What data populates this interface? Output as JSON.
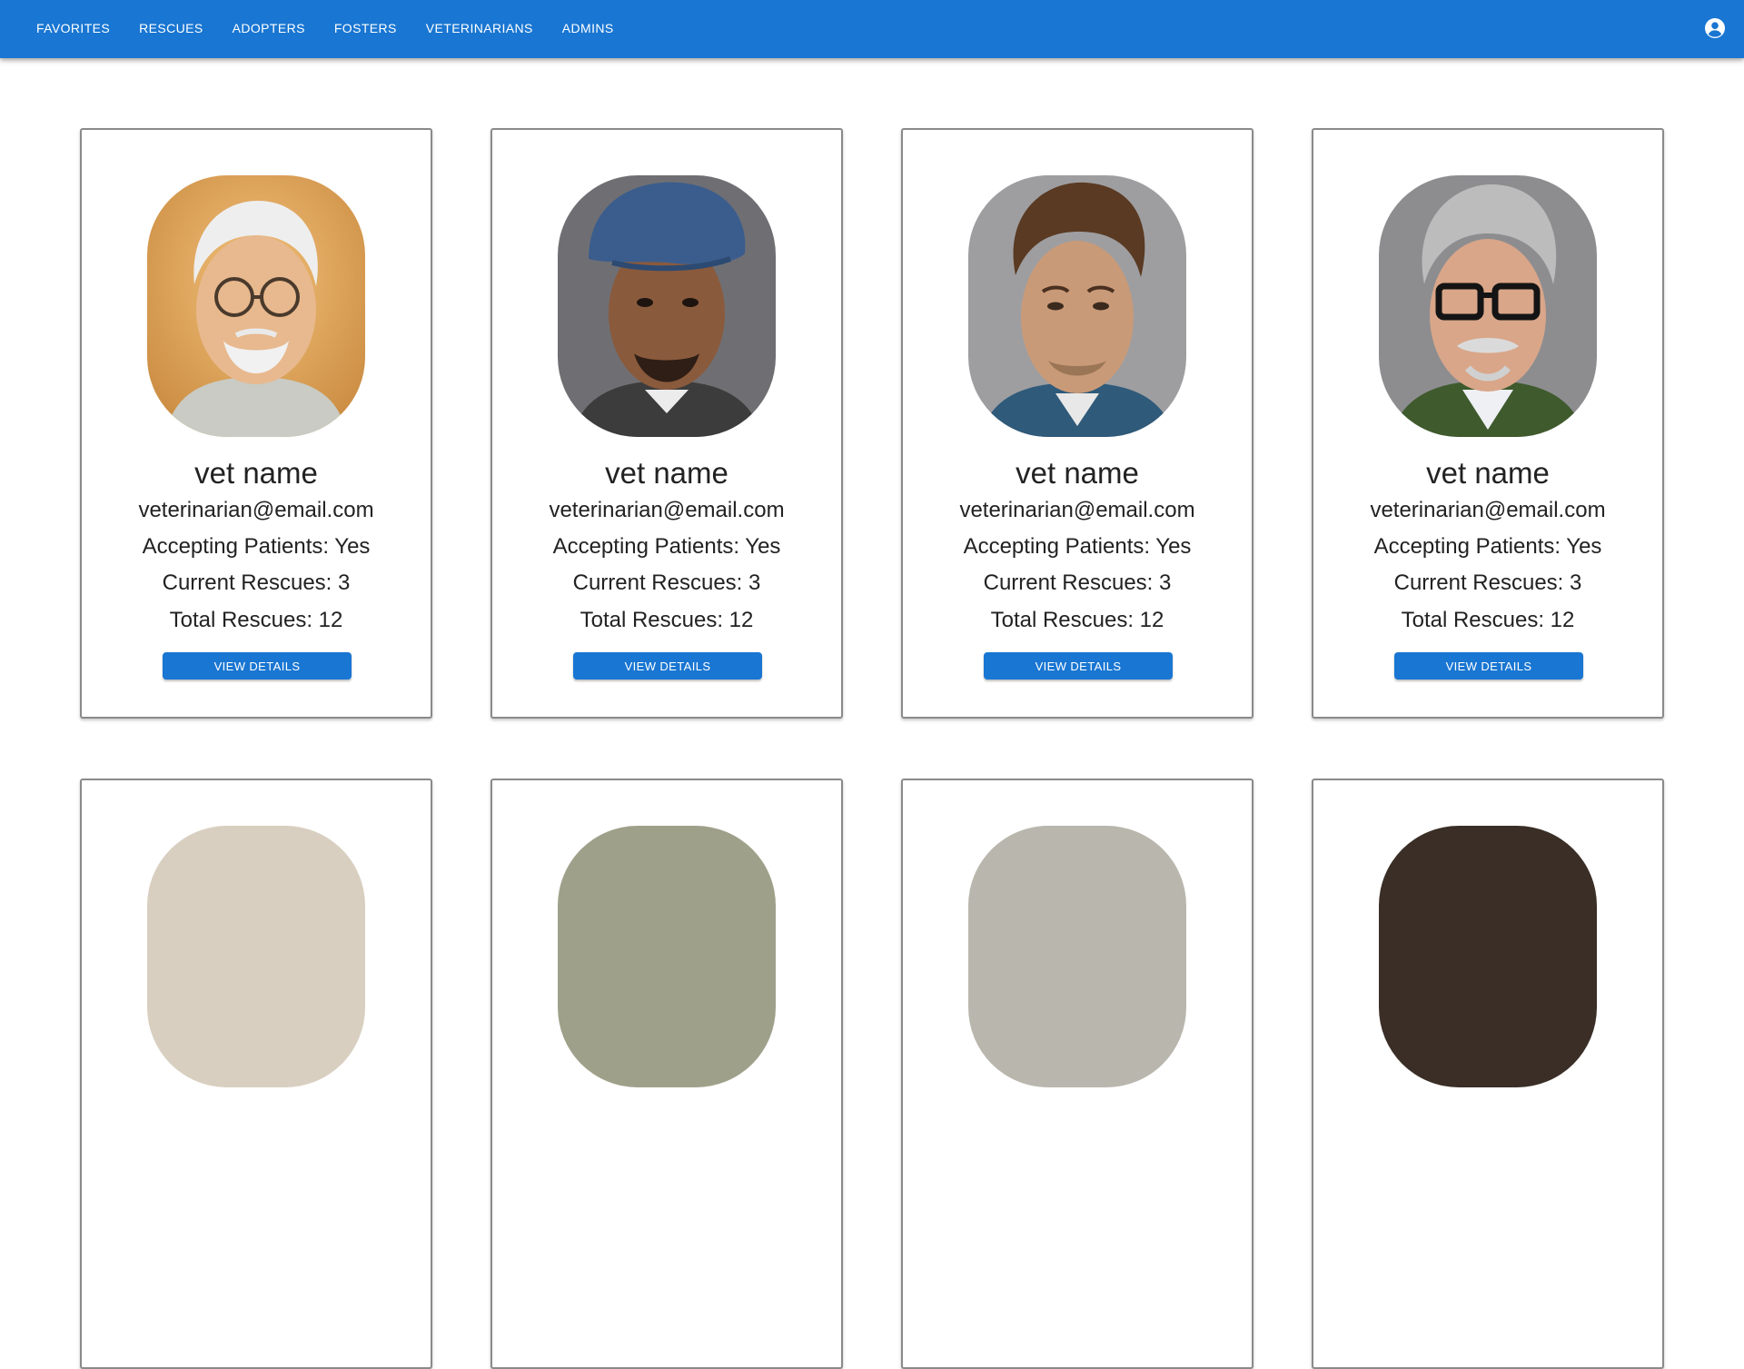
{
  "nav": {
    "items": [
      "FAVORITES",
      "RESCUES",
      "ADOPTERS",
      "FOSTERS",
      "VETERINARIANS",
      "ADMINS"
    ]
  },
  "account": {
    "icon": "account-circle-icon"
  },
  "colors": {
    "primary": "#1976d2",
    "card_border": "#8a8a8a"
  },
  "vets": [
    {
      "name": "vet name",
      "email": "veterinarian@email.com",
      "accepting": "Accepting Patients: Yes",
      "current": "Current Rescues: 3",
      "total": "Total Rescues: 12",
      "button": "VIEW DETAILS"
    },
    {
      "name": "vet name",
      "email": "veterinarian@email.com",
      "accepting": "Accepting Patients: Yes",
      "current": "Current Rescues: 3",
      "total": "Total Rescues: 12",
      "button": "VIEW DETAILS"
    },
    {
      "name": "vet name",
      "email": "veterinarian@email.com",
      "accepting": "Accepting Patients: Yes",
      "current": "Current Rescues: 3",
      "total": "Total Rescues: 12",
      "button": "VIEW DETAILS"
    },
    {
      "name": "vet name",
      "email": "veterinarian@email.com",
      "accepting": "Accepting Patients: Yes",
      "current": "Current Rescues: 3",
      "total": "Total Rescues: 12",
      "button": "VIEW DETAILS"
    }
  ]
}
